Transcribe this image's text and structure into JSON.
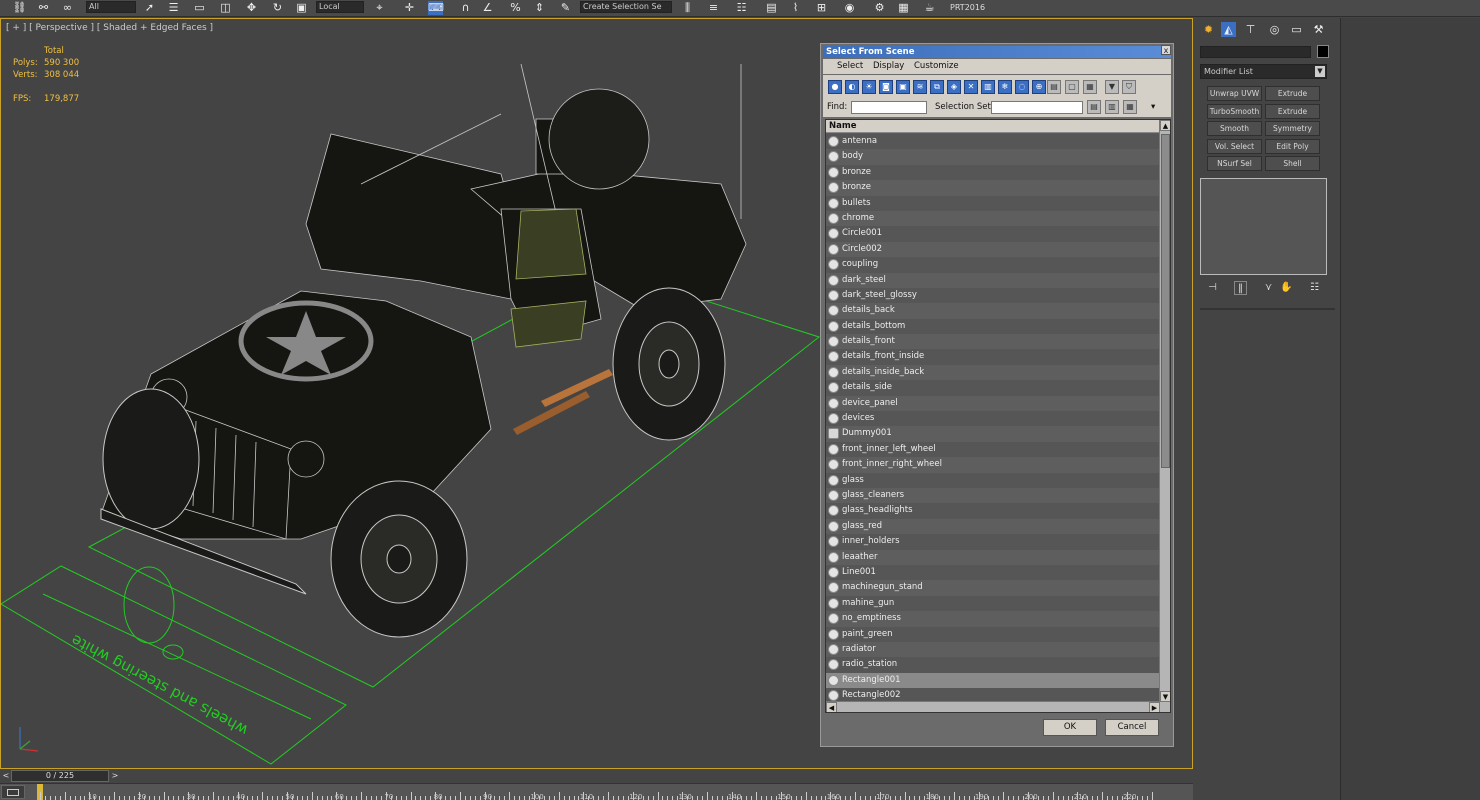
{
  "toolbar": {
    "coord_system": "Local",
    "view_field": "All",
    "selection_set": "Create Selection Se",
    "project_label": "PRT2016"
  },
  "viewport": {
    "label": "[ + ] [ Perspective ] [ Shaded + Edged Faces ]",
    "stats": {
      "total_label": "Total",
      "polys_label": "Polys:",
      "polys_value": "590 300",
      "verts_label": "Verts:",
      "verts_value": "308 044",
      "fps_label": "FPS:",
      "fps_value": "179,877"
    },
    "ground_text": "wheels and steering white",
    "highlight_color": "#c9a227",
    "helper_color": "#22cc22"
  },
  "dialog": {
    "title": "Select From Scene",
    "close_label": "x",
    "menu": [
      "Select",
      "Display",
      "Customize"
    ],
    "find_label": "Find:",
    "find_value": "",
    "selection_set_label": "Selection Set:",
    "selection_set_value": "",
    "column_header": "Name",
    "items": [
      {
        "name": "antenna",
        "kind": "geometry"
      },
      {
        "name": "body",
        "kind": "geometry"
      },
      {
        "name": "bronze",
        "kind": "geometry"
      },
      {
        "name": "bronze",
        "kind": "geometry"
      },
      {
        "name": "bullets",
        "kind": "geometry"
      },
      {
        "name": "chrome",
        "kind": "geometry"
      },
      {
        "name": "Circle001",
        "kind": "shape"
      },
      {
        "name": "Circle002",
        "kind": "shape"
      },
      {
        "name": "coupling",
        "kind": "geometry"
      },
      {
        "name": "dark_steel",
        "kind": "geometry"
      },
      {
        "name": "dark_steel_glossy",
        "kind": "geometry"
      },
      {
        "name": "details_back",
        "kind": "geometry"
      },
      {
        "name": "details_bottom",
        "kind": "geometry"
      },
      {
        "name": "details_front",
        "kind": "geometry"
      },
      {
        "name": "details_front_inside",
        "kind": "geometry"
      },
      {
        "name": "details_inside_back",
        "kind": "geometry"
      },
      {
        "name": "details_side",
        "kind": "geometry"
      },
      {
        "name": "device_panel",
        "kind": "geometry"
      },
      {
        "name": "devices",
        "kind": "geometry"
      },
      {
        "name": "Dummy001",
        "kind": "helper"
      },
      {
        "name": "front_inner_left_wheel",
        "kind": "geometry"
      },
      {
        "name": "front_inner_right_wheel",
        "kind": "geometry"
      },
      {
        "name": "glass",
        "kind": "geometry"
      },
      {
        "name": "glass_cleaners",
        "kind": "geometry"
      },
      {
        "name": "glass_headlights",
        "kind": "geometry"
      },
      {
        "name": "glass_red",
        "kind": "geometry"
      },
      {
        "name": "inner_holders",
        "kind": "geometry"
      },
      {
        "name": "leaather",
        "kind": "geometry"
      },
      {
        "name": "Line001",
        "kind": "shape"
      },
      {
        "name": "machinegun_stand",
        "kind": "geometry"
      },
      {
        "name": "mahine_gun",
        "kind": "geometry"
      },
      {
        "name": "no_emptiness",
        "kind": "geometry"
      },
      {
        "name": "paint_green",
        "kind": "geometry"
      },
      {
        "name": "radiator",
        "kind": "geometry"
      },
      {
        "name": "radio_station",
        "kind": "geometry"
      },
      {
        "name": "Rectangle001",
        "kind": "shape",
        "selected": true
      },
      {
        "name": "Rectangle002",
        "kind": "shape"
      }
    ],
    "ok_label": "OK",
    "cancel_label": "Cancel"
  },
  "command_panel": {
    "modifier_list_label": "Modifier List",
    "modifier_buttons": [
      [
        "Unwrap UVW",
        "Extrude"
      ],
      [
        "TurboSmooth",
        "Extrude"
      ],
      [
        "Smooth",
        "Symmetry"
      ],
      [
        "Vol. Select",
        "Edit Poly"
      ],
      [
        "NSurf Sel",
        "Shell"
      ]
    ]
  },
  "timeline": {
    "frame_display": "0 / 225",
    "prev_label": "<",
    "next_label": ">",
    "ruler_numbers": [
      "10",
      "20",
      "30",
      "40",
      "50",
      "60",
      "70",
      "80",
      "90",
      "100",
      "110",
      "120",
      "130",
      "140",
      "150",
      "160",
      "170",
      "180",
      "190",
      "200",
      "210",
      "220"
    ]
  }
}
